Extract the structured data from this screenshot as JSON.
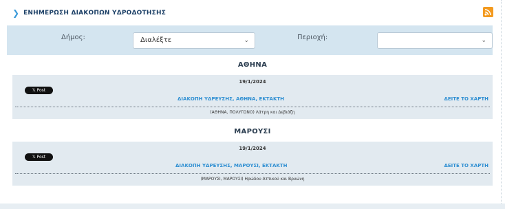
{
  "header": {
    "title": "ΕΝΗΜΕΡΩΣΗ ΔΙΑΚΟΠΩΝ ΥΔΡΟΔΟΤΗΣΗΣ",
    "chevron_icon": "chevron-right-icon",
    "rss_icon": "rss-icon"
  },
  "filters": {
    "municipality_label": "Δήμος:",
    "municipality_value": "Διαλέξτε",
    "area_label": "Περιοχή:",
    "area_value": ""
  },
  "groups": [
    {
      "city": "ΑΘΗΝΑ",
      "date": "19/1/2024",
      "share_label": "𝕏 Post",
      "title": "ΔΙΑΚΟΠΗ ΥΔΡΕΥΣΗΣ, ΑΘΗΝΑ, ΕΚΤΑΚΤΗ",
      "map_link": "ΔΕΙΤΕ ΤΟ ΧΑΡΤΗ",
      "description": "(ΑΘΗΝΑ, ΠΟΛΥΓΩΝΟ) Λάτρη και Δεβιάζη"
    },
    {
      "city": "ΜΑΡΟΥΣΙ",
      "date": "19/1/2024",
      "share_label": "𝕏 Post",
      "title": "ΔΙΑΚΟΠΗ ΥΔΡΕΥΣΗΣ, ΜΑΡΟΥΣΙ, ΕΚΤΑΚΤΗ",
      "map_link": "ΔΕΙΤΕ ΤΟ ΧΑΡΤΗ",
      "description": "(ΜΑΡΟΥΣΙ, ΜΑΡΟΥΣΙ) Ηρώδου Αττικού και Βρυώνη"
    }
  ],
  "colors": {
    "accent": "#2f8fd2",
    "filter_bg": "#d4e5f0",
    "card_bg": "#e2eaf0",
    "rss": "#f39a1f"
  }
}
